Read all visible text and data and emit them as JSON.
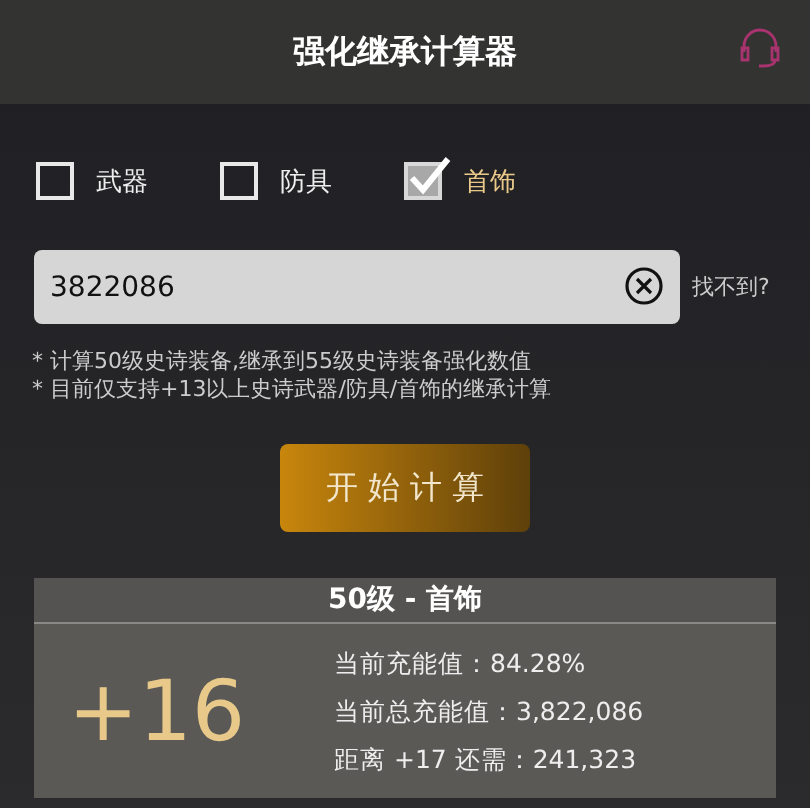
{
  "header": {
    "title": "强化继承计算器"
  },
  "categories": [
    {
      "label": "武器",
      "checked": false
    },
    {
      "label": "防具",
      "checked": false
    },
    {
      "label": "首饰",
      "checked": true
    }
  ],
  "search": {
    "value": "3822086",
    "help_link": "找不到?"
  },
  "notes": [
    "* 计算50级史诗装备,继承到55级史诗装备强化数值",
    "* 目前仅支持+13以上史诗武器/防具/首饰的继承计算"
  ],
  "calculate_button": "开 始 计 算",
  "result": {
    "title": "50级 - 首饰",
    "level": "+16",
    "lines": [
      "当前充能值：84.28%",
      "当前总充能值：3,822,086",
      "距离 +17 还需：241,323"
    ]
  }
}
